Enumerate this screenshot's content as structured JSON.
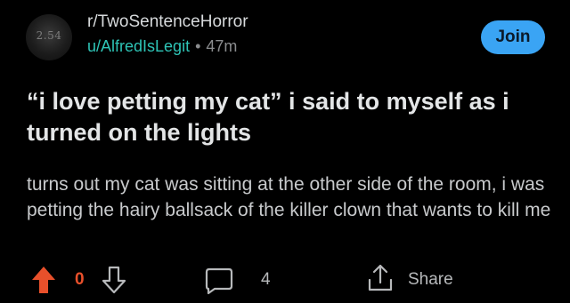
{
  "header": {
    "avatar_text": "2.54",
    "subreddit": "r/TwoSentenceHorror",
    "username": "u/AlfredIsLegit",
    "separator": "•",
    "time_ago": "47m",
    "join_label": "Join"
  },
  "post": {
    "title": "“i love petting my cat” i said to myself as i turned on the lights",
    "body": "turns out my cat was sitting at the other side of the room, i was petting the hairy ballsack of the killer clown that wants to kill me"
  },
  "actions": {
    "vote_count": "0",
    "comment_count": "4",
    "share_label": "Share"
  },
  "colors": {
    "background": "#000000",
    "username": "#2ec4b6",
    "join_button": "#3aa4f4",
    "upvote_active": "#e8502b"
  },
  "icons": {
    "upvote": "upvote-arrow-icon",
    "downvote": "downvote-arrow-icon",
    "comment": "comment-bubble-icon",
    "share": "share-icon"
  }
}
